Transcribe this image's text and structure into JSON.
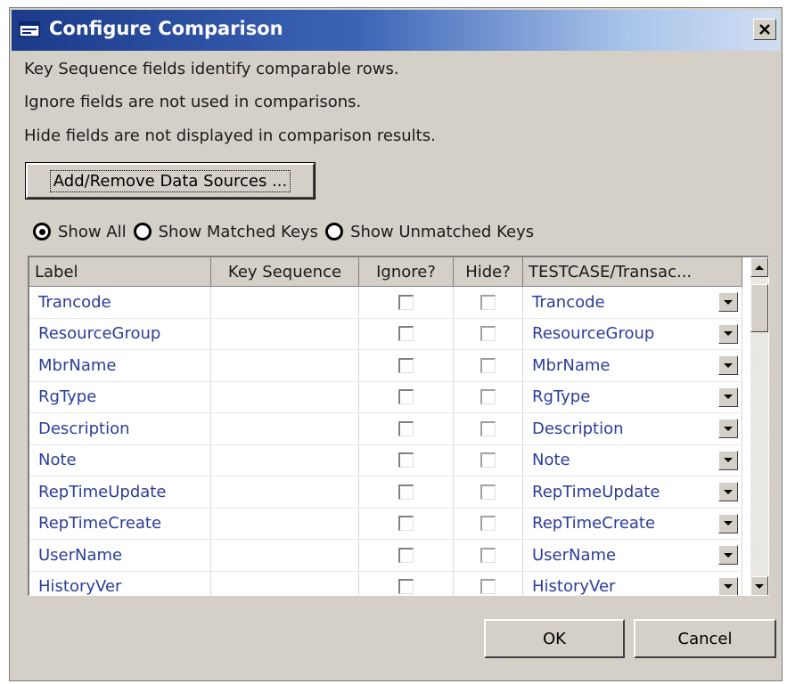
{
  "dialog": {
    "title": "Configure Comparison",
    "close_label": "×"
  },
  "info": {
    "line1": "Key Sequence fields identify comparable rows.",
    "line2": "Ignore fields are not used in comparisons.",
    "line3": "Hide fields are not displayed in comparison results."
  },
  "toolbar": {
    "add_remove_label": "Add/Remove Data Sources ..."
  },
  "filters": {
    "selected": "Show All",
    "options": [
      {
        "label": "Show All",
        "checked": true
      },
      {
        "label": "Show Matched Keys",
        "checked": false
      },
      {
        "label": "Show Unmatched Keys",
        "checked": false
      }
    ]
  },
  "table": {
    "headers": [
      "Label",
      "Key Sequence",
      "Ignore?",
      "Hide?",
      "TESTCASE/Transac..."
    ],
    "rows": [
      {
        "label": "Trancode",
        "key_sequence": "",
        "ignore": false,
        "hide": false,
        "source": "Trancode"
      },
      {
        "label": "ResourceGroup",
        "key_sequence": "",
        "ignore": false,
        "hide": false,
        "source": "ResourceGroup"
      },
      {
        "label": "MbrName",
        "key_sequence": "",
        "ignore": false,
        "hide": false,
        "source": "MbrName"
      },
      {
        "label": "RgType",
        "key_sequence": "",
        "ignore": false,
        "hide": false,
        "source": "RgType"
      },
      {
        "label": "Description",
        "key_sequence": "",
        "ignore": false,
        "hide": false,
        "source": "Description"
      },
      {
        "label": "Note",
        "key_sequence": "",
        "ignore": false,
        "hide": false,
        "source": "Note"
      },
      {
        "label": "RepTimeUpdate",
        "key_sequence": "",
        "ignore": false,
        "hide": false,
        "source": "RepTimeUpdate"
      },
      {
        "label": "RepTimeCreate",
        "key_sequence": "",
        "ignore": false,
        "hide": false,
        "source": "RepTimeCreate"
      },
      {
        "label": "UserName",
        "key_sequence": "",
        "ignore": false,
        "hide": false,
        "source": "UserName"
      },
      {
        "label": "HistoryVer",
        "key_sequence": "",
        "ignore": false,
        "hide": false,
        "source": "HistoryVer"
      }
    ]
  },
  "footer": {
    "ok_label": "OK",
    "cancel_label": "Cancel"
  },
  "colors": {
    "titlebar_start": "#1b3a8a",
    "titlebar_end": "#d0def2",
    "dialog_bg": "#d4d0c8",
    "cell_text": "#2a3d9a"
  },
  "icons": {
    "title": "dialog-window-icon",
    "close": "close-icon",
    "dropdown": "chevron-down-icon",
    "scroll_up": "scroll-up-arrow-icon",
    "scroll_down": "scroll-down-arrow-icon"
  }
}
